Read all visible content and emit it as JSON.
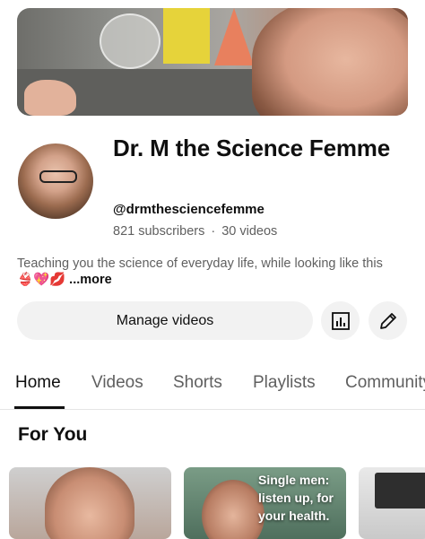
{
  "channel": {
    "name": "Dr. M the Science Femme",
    "handle": "@drmthesciencefemme",
    "subscribers": "821 subscribers",
    "videos": "30 videos",
    "separator": "·",
    "description": "Teaching you the science of everyday life, while looking like this",
    "description_emojis": "👙💖💋",
    "more_label": "...more"
  },
  "actions": {
    "manage_videos_label": "Manage videos",
    "analytics_icon": "bar-chart-icon",
    "edit_icon": "pencil-icon"
  },
  "tabs": [
    {
      "label": "Home",
      "active": true
    },
    {
      "label": "Videos"
    },
    {
      "label": "Shorts"
    },
    {
      "label": "Playlists"
    },
    {
      "label": "Community"
    }
  ],
  "for_you": {
    "title": "For You",
    "cards": [
      {
        "caption": ""
      },
      {
        "caption": "Single men: listen up, for your health."
      },
      {
        "caption": ""
      }
    ]
  }
}
